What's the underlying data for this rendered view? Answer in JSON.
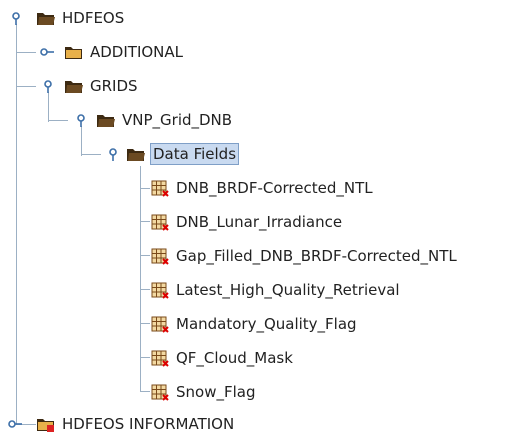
{
  "tree": {
    "root": {
      "label": "HDFEOS",
      "icon": "folder-open-icon"
    },
    "additional": {
      "label": "ADDITIONAL",
      "icon": "folder-closed-icon"
    },
    "grids": {
      "label": "GRIDS",
      "icon": "folder-open-icon"
    },
    "vnp_grid": {
      "label": "VNP_Grid_DNB",
      "icon": "folder-open-icon"
    },
    "data_fields": {
      "label": "Data Fields",
      "icon": "folder-open-icon",
      "selected": true
    },
    "datasets": [
      {
        "label": "DNB_BRDF-Corrected_NTL",
        "icon": "dataset-icon"
      },
      {
        "label": "DNB_Lunar_Irradiance",
        "icon": "dataset-icon"
      },
      {
        "label": "Gap_Filled_DNB_BRDF-Corrected_NTL",
        "icon": "dataset-icon"
      },
      {
        "label": "Latest_High_Quality_Retrieval",
        "icon": "dataset-icon"
      },
      {
        "label": "Mandatory_Quality_Flag",
        "icon": "dataset-icon"
      },
      {
        "label": "QF_Cloud_Mask",
        "icon": "dataset-icon"
      },
      {
        "label": "Snow_Flag",
        "icon": "dataset-icon"
      }
    ],
    "info": {
      "label": "HDFEOS INFORMATION",
      "icon": "folder-attribute-icon"
    }
  },
  "colors": {
    "folder": "#6b4a22",
    "folder_dark": "#3d2a12",
    "folder_light": "#e8b04a",
    "connector": "#9cb0c4",
    "selection_bg": "#c9daf0",
    "selection_border": "#7f9fc7",
    "handle": "#3d6fa8"
  }
}
